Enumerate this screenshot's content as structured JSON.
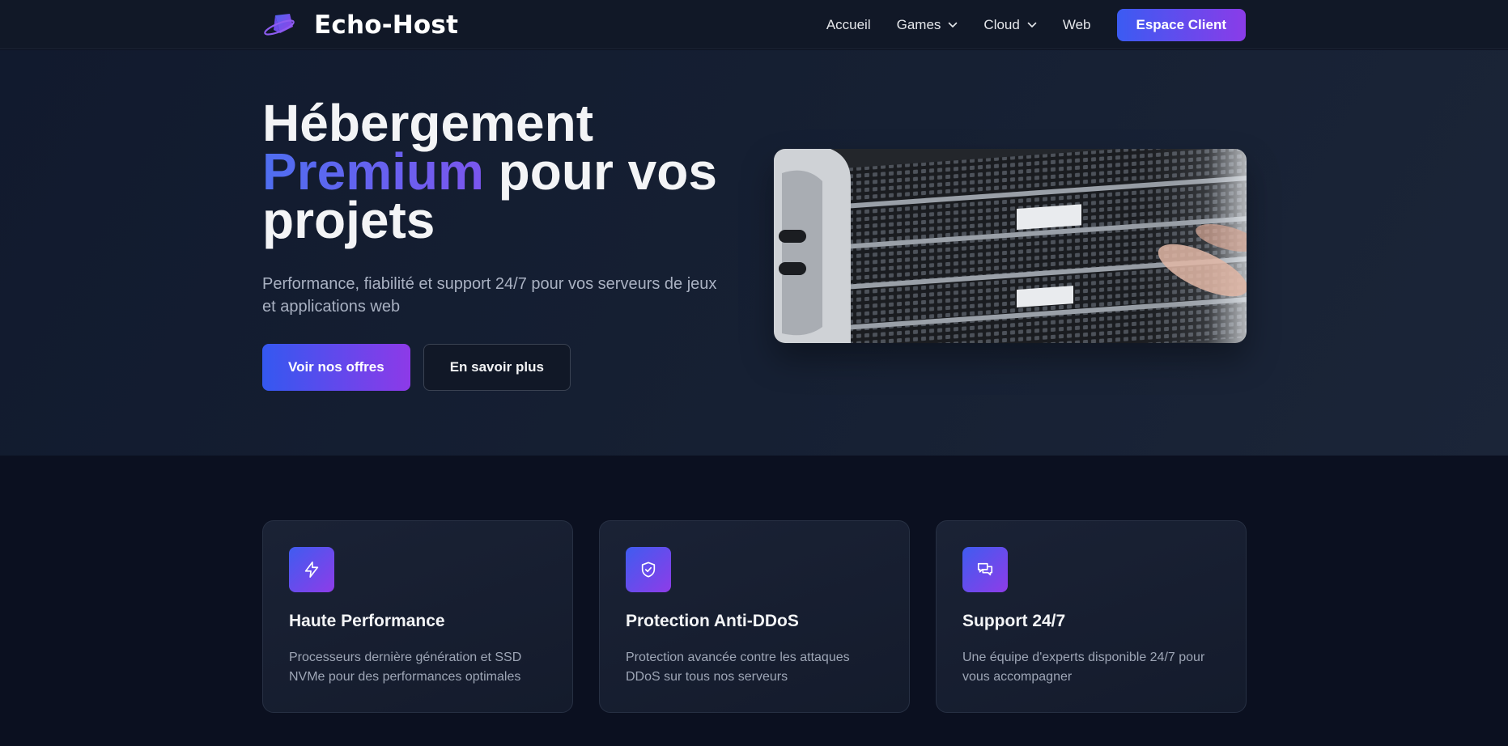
{
  "brand": {
    "name": "Echo-Host",
    "logo_icon": "planet-logo-icon"
  },
  "nav": {
    "items": [
      {
        "label": "Accueil",
        "dropdown": false
      },
      {
        "label": "Games",
        "dropdown": true
      },
      {
        "label": "Cloud",
        "dropdown": true
      },
      {
        "label": "Web",
        "dropdown": false
      }
    ],
    "client_button": "Espace Client"
  },
  "hero": {
    "title_line1": "Hébergement",
    "title_accent": "Premium",
    "title_line2_rest": " pour vos",
    "title_line3": "projets",
    "subtitle": "Performance, fiabilité et support 24/7 pour vos serveurs de jeux et applications web",
    "primary_button": "Voir nos offres",
    "secondary_button": "En savoir plus",
    "image_alt": "server-rack-photo"
  },
  "features": [
    {
      "icon": "lightning-icon",
      "title": "Haute Performance",
      "text": "Processeurs dernière génération et SSD NVMe pour des performances optimales"
    },
    {
      "icon": "shield-check-icon",
      "title": "Protection Anti-DDoS",
      "text": "Protection avancée contre les attaques DDoS sur tous nos serveurs"
    },
    {
      "icon": "chat-bubbles-icon",
      "title": "Support 24/7",
      "text": "Une équipe d'experts disponible 24/7 pour vous accompagner"
    }
  ],
  "colors": {
    "accent_start": "#3b5bf2",
    "accent_end": "#8a3ce8",
    "background": "#0b1020",
    "hero_background": "#162033"
  }
}
